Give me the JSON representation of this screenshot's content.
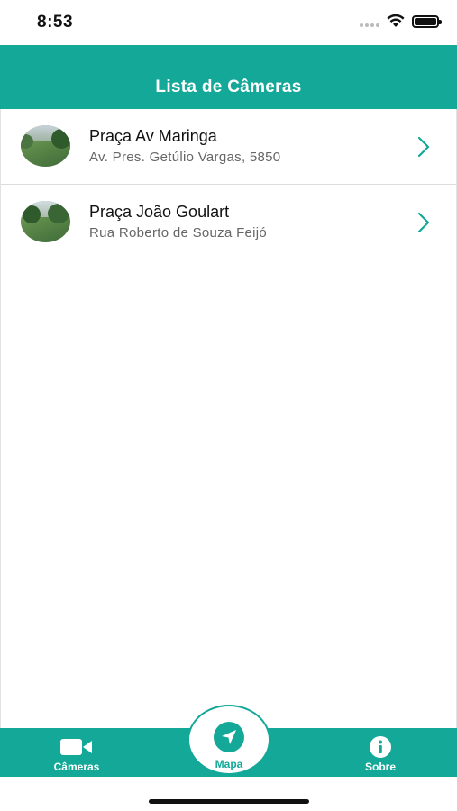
{
  "status_bar": {
    "time": "8:53",
    "icons": [
      "cellular-signal-icon",
      "wifi-icon",
      "battery-icon"
    ]
  },
  "nav": {
    "title": "Lista de Câmeras"
  },
  "cameras": [
    {
      "title": "Praça Av Maringa",
      "address": "Av. Pres. Getúlio Vargas, 5850",
      "icon": "camera-thumbnail"
    },
    {
      "title": "Praça João Goulart",
      "address": "Rua Roberto de Souza Feijó",
      "icon": "camera-thumbnail"
    }
  ],
  "tab_bar": {
    "cameras_label": "Câmeras",
    "map_label": "Mapa",
    "about_label": "Sobre"
  },
  "colors": {
    "accent": "#14a898",
    "text_primary": "#111111",
    "text_secondary": "#666666",
    "background": "#ffffff"
  }
}
